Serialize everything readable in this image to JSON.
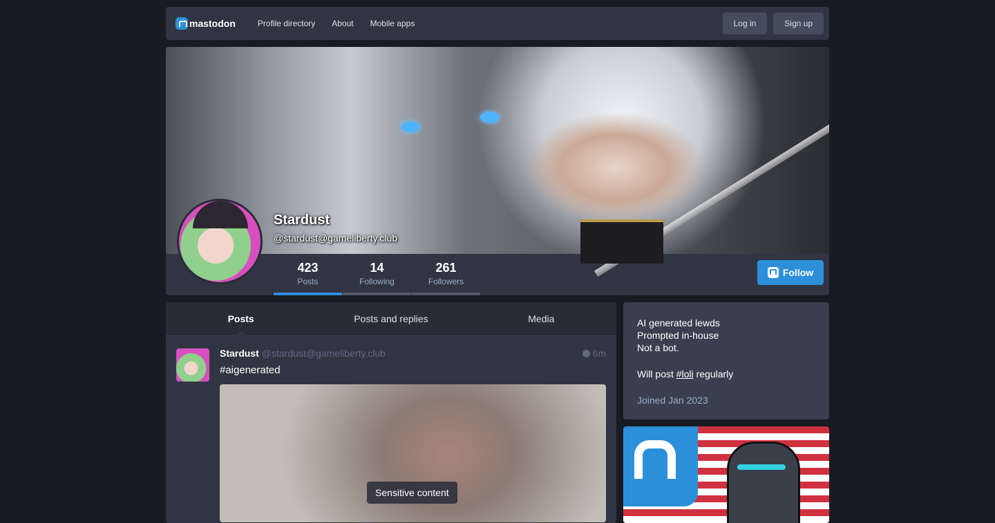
{
  "nav": {
    "brand": "mastodon",
    "links": [
      "Profile directory",
      "About",
      "Mobile apps"
    ],
    "login": "Log in",
    "signup": "Sign up"
  },
  "profile": {
    "display_name": "Stardust",
    "handle": "@stardust@gameliberty.club",
    "stats": [
      {
        "value": "423",
        "label": "Posts"
      },
      {
        "value": "14",
        "label": "Following"
      },
      {
        "value": "261",
        "label": "Followers"
      }
    ],
    "follow": "Follow"
  },
  "tabs": [
    "Posts",
    "Posts and replies",
    "Media"
  ],
  "post": {
    "author": "Stardust",
    "handle": "@stardust@gameliberty.club",
    "time": "6m",
    "text": "#aigenerated",
    "media_label": "Sensitive content"
  },
  "bio": {
    "lines": [
      "AI generated lewds",
      "Prompted in-house",
      "Not a bot."
    ],
    "line4_prefix": "Will post ",
    "line4_tag": "#loli",
    "line4_suffix": " regularly",
    "joined": "Joined Jan 2023"
  },
  "colors": {
    "accent": "#2b90d9",
    "background": "#191b22",
    "panel": "#313543"
  }
}
